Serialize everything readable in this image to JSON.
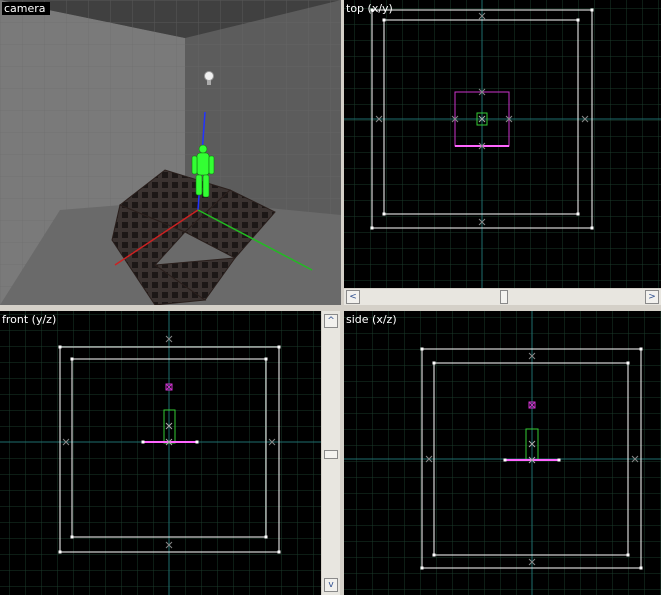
{
  "viewports": {
    "camera": {
      "label": "camera"
    },
    "top": {
      "label": "top (x/y)"
    },
    "front": {
      "label": "front (y/z)"
    },
    "side": {
      "label": "side (x/z)"
    }
  },
  "scrollbars": {
    "top_view_horizontal": {
      "left_arrow": "<",
      "right_arrow": ">"
    },
    "front_view_vertical": {
      "up_arrow": "^",
      "down_arrow": "v"
    }
  },
  "icons": {
    "light_bulb": "light-bulb-icon",
    "player_model": "player-model-icon",
    "entity_marker": "x"
  },
  "colors": {
    "grid_minor": "#1a3a2a",
    "grid_axis": "#1e6e6e",
    "brush": "#ffffff",
    "selection": "#cc33cc",
    "entity": "#33cc33",
    "viewport_bg": "#000000",
    "chrome": "#d4d0c8"
  }
}
